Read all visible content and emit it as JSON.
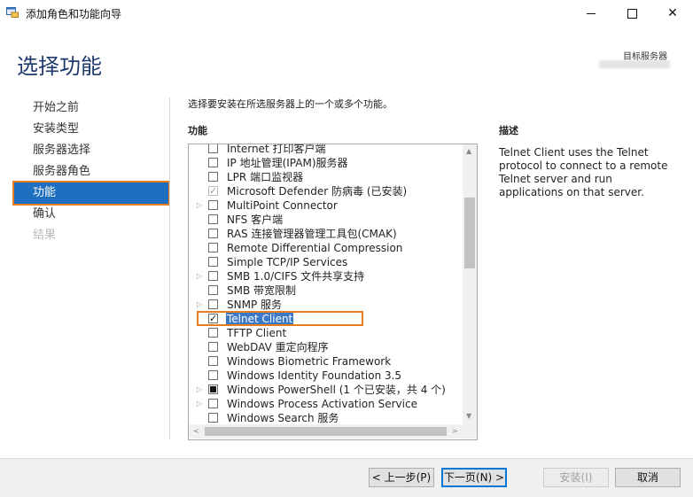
{
  "window": {
    "title": "添加角色和功能向导",
    "minimize_label": "—",
    "close_label": "✕"
  },
  "page": {
    "title": "选择功能",
    "dest_server_label": "目标服务器"
  },
  "nav": {
    "items": [
      {
        "label": "开始之前",
        "state": "normal"
      },
      {
        "label": "安装类型",
        "state": "normal"
      },
      {
        "label": "服务器选择",
        "state": "normal"
      },
      {
        "label": "服务器角色",
        "state": "normal"
      },
      {
        "label": "功能",
        "state": "active"
      },
      {
        "label": "确认",
        "state": "normal"
      },
      {
        "label": "结果",
        "state": "disabled"
      }
    ]
  },
  "main": {
    "intro": "选择要安装在所选服务器上的一个或多个功能。",
    "features_heading": "功能",
    "description_heading": "描述",
    "description": "Telnet Client uses the Telnet protocol to connect to a remote Telnet server and run applications on that server."
  },
  "features": [
    {
      "label": "Internet 打印客户端",
      "checked": false,
      "expandable": false
    },
    {
      "label": "IP 地址管理(IPAM)服务器",
      "checked": false,
      "expandable": false
    },
    {
      "label": "LPR 端口监视器",
      "checked": false,
      "expandable": false
    },
    {
      "label": "Microsoft Defender 防病毒 (已安装)",
      "checked": true,
      "disabled": true,
      "expandable": false
    },
    {
      "label": "MultiPoint Connector",
      "checked": false,
      "expandable": true
    },
    {
      "label": "NFS 客户端",
      "checked": false,
      "expandable": false
    },
    {
      "label": "RAS 连接管理器管理工具包(CMAK)",
      "checked": false,
      "expandable": false
    },
    {
      "label": "Remote Differential Compression",
      "checked": false,
      "expandable": false
    },
    {
      "label": "Simple TCP/IP Services",
      "checked": false,
      "expandable": false
    },
    {
      "label": "SMB 1.0/CIFS 文件共享支持",
      "checked": false,
      "expandable": true
    },
    {
      "label": "SMB 带宽限制",
      "checked": false,
      "expandable": false
    },
    {
      "label": "SNMP 服务",
      "checked": false,
      "expandable": true
    },
    {
      "label": "Telnet Client",
      "checked": true,
      "selected": true,
      "expandable": false
    },
    {
      "label": "TFTP Client",
      "checked": false,
      "expandable": false
    },
    {
      "label": "WebDAV 重定向程序",
      "checked": false,
      "expandable": false
    },
    {
      "label": "Windows Biometric Framework",
      "checked": false,
      "expandable": false
    },
    {
      "label": "Windows Identity Foundation 3.5",
      "checked": false,
      "expandable": false
    },
    {
      "label": "Windows PowerShell (1 个已安装，共 4 个)",
      "partial": true,
      "expandable": true
    },
    {
      "label": "Windows Process Activation Service",
      "checked": false,
      "expandable": true
    },
    {
      "label": "Windows Search 服务",
      "checked": false,
      "expandable": false
    }
  ],
  "footer": {
    "prev_label": "< 上一步(P)",
    "next_label": "下一页(N) >",
    "install_label": "安装(I)",
    "cancel_label": "取消"
  },
  "colors": {
    "accent": "#1e6fbf",
    "highlight_box": "#ea7d1b",
    "title": "#1e3a6d",
    "selection": "#3b79c6"
  }
}
